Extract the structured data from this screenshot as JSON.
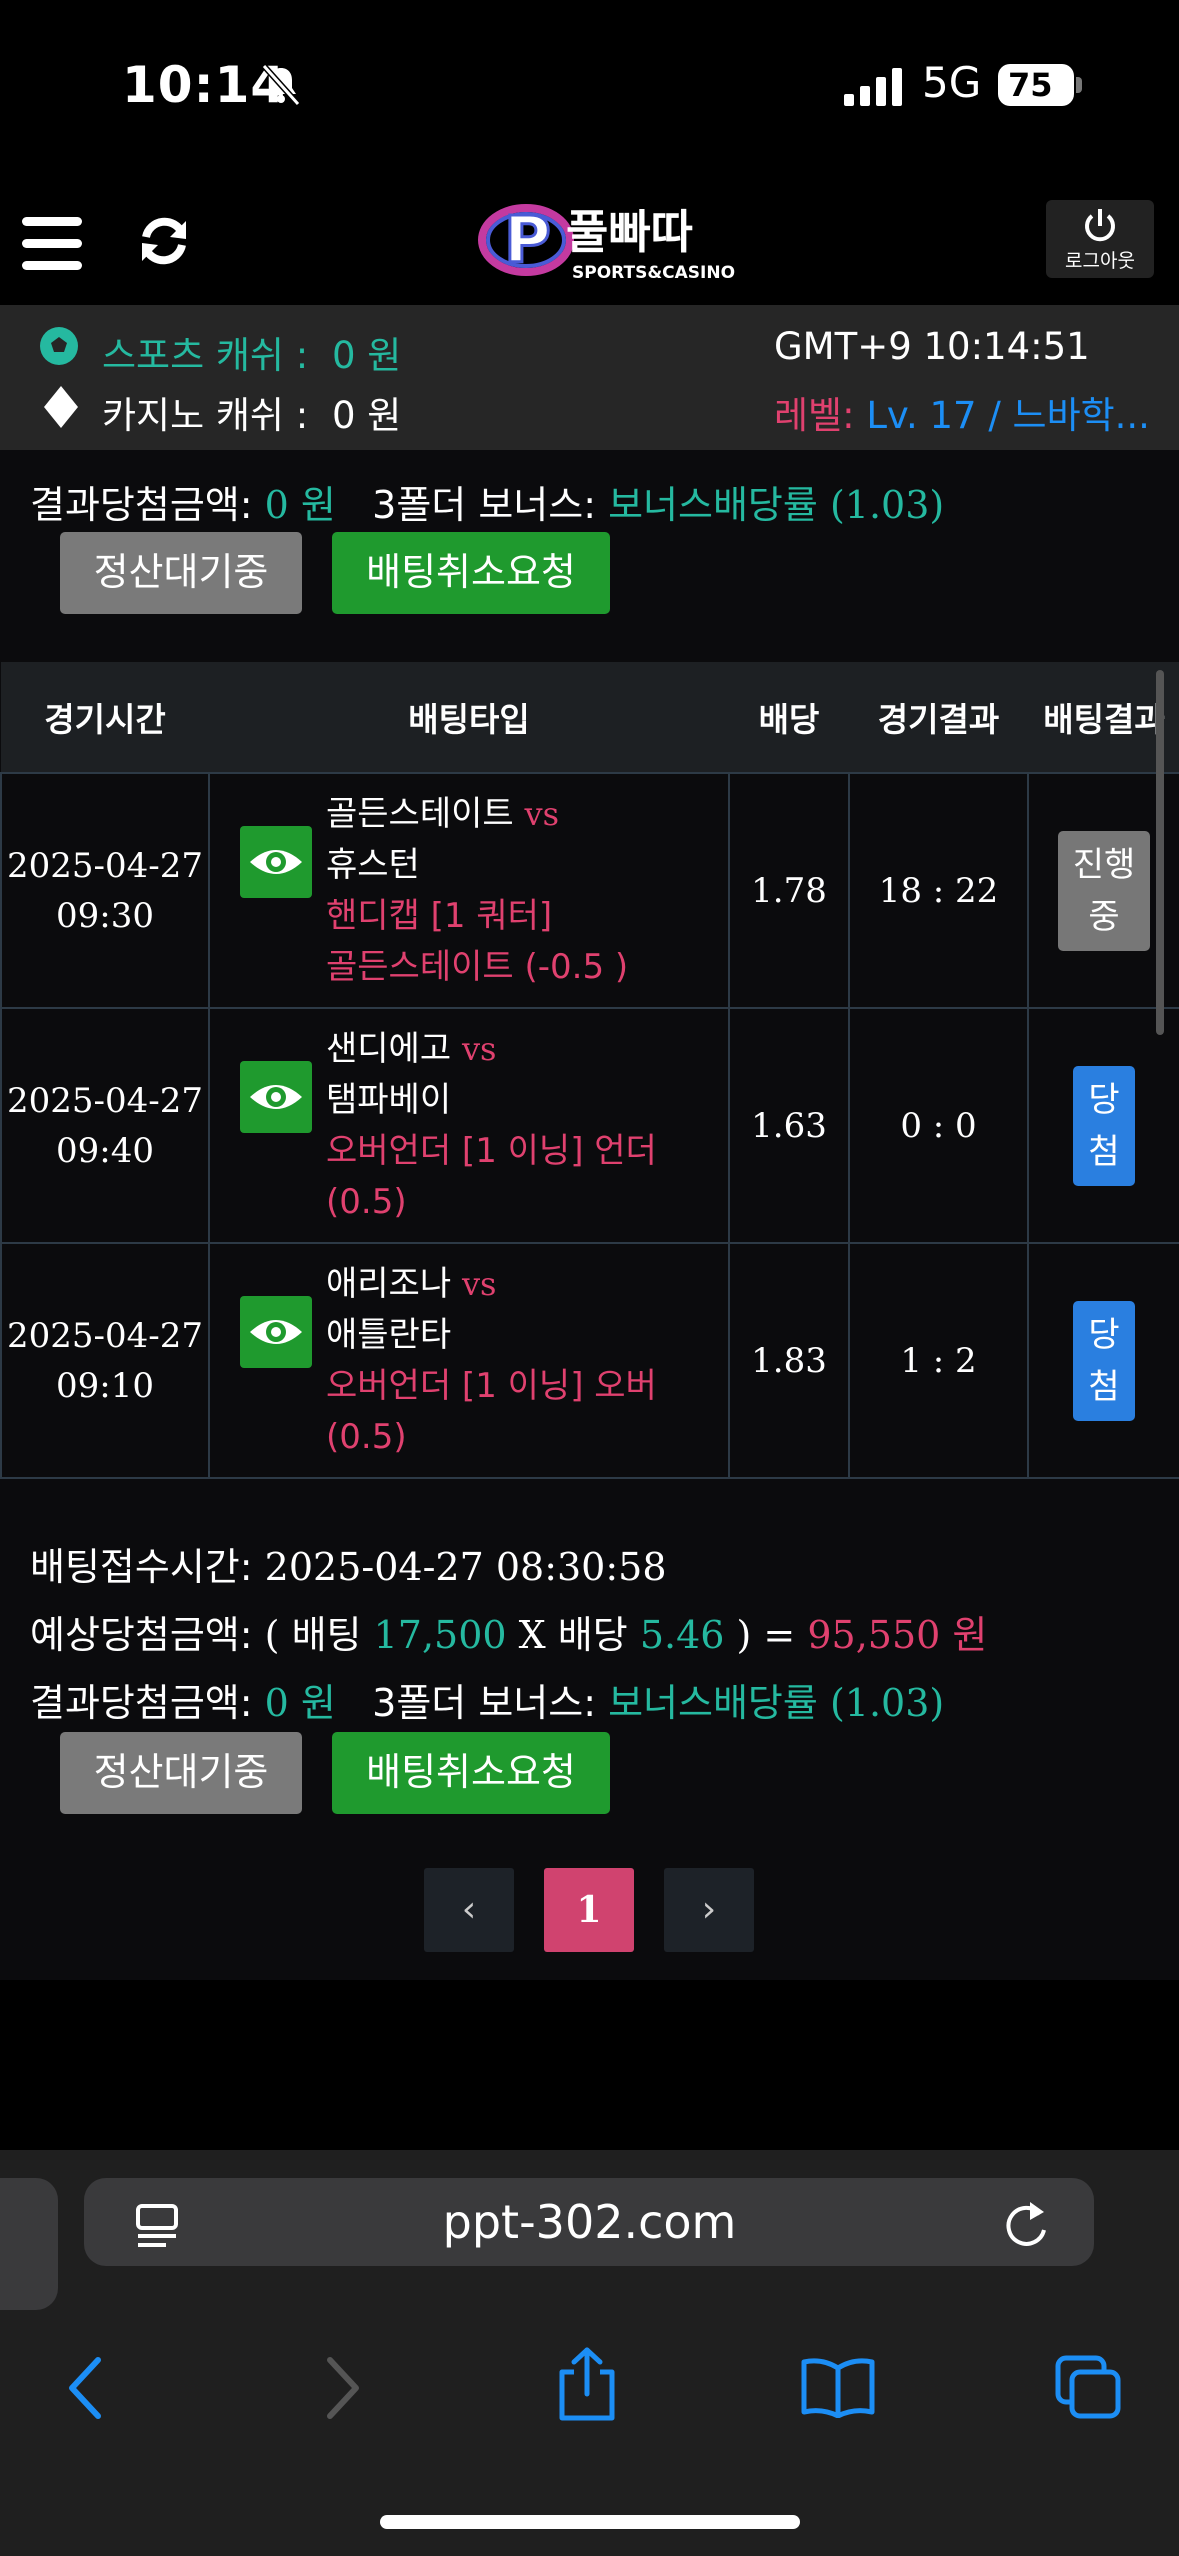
{
  "status_bar": {
    "time": "10:14",
    "network": "5G",
    "battery": "75"
  },
  "header": {
    "logo_text": "풀빠따",
    "logo_sub": "SPORTS&CASINO",
    "logout_label": "로그아웃"
  },
  "info": {
    "sports_cash_label": "스포츠 캐쉬 :",
    "sports_cash_value": "0 원",
    "casino_cash_label": "카지노 캐쉬 :",
    "casino_cash_value": "0 원",
    "clock": "GMT+9 10:14:51",
    "level_label": "레벨:",
    "level_value": "Lv. 17 / 느바학..."
  },
  "top_summary": {
    "result_label": "결과당첨금액:",
    "result_value": "0 원",
    "bonus_label": "3폴더 보너스:",
    "bonus_value": "보너스배당률",
    "bonus_rate": "(1.03)",
    "pending_label": "정산대기중",
    "cancel_label": "배팅취소요청"
  },
  "table": {
    "headers": [
      "경기시간",
      "배팅타입",
      "배당",
      "경기결과",
      "배팅결과"
    ],
    "rows": [
      {
        "date": "2025-04-27",
        "time": "09:30",
        "home": "골든스테이트",
        "vs": "vs",
        "away": "휴스턴",
        "bet_type": "핸디캡 [1 쿼터]",
        "pick": "골든스테이트 (-0.5 )",
        "odds": "1.78",
        "score": "18 : 22",
        "result": "진행중",
        "result_color": "#777777"
      },
      {
        "date": "2025-04-27",
        "time": "09:40",
        "home": "샌디에고",
        "vs": "vs",
        "away": "탬파베이",
        "bet_type": "오버언더 [1 이닝] 언더",
        "pick": "(0.5)",
        "odds": "1.63",
        "score": "0 : 0",
        "result": "당첨",
        "result_color": "#2a7fe0"
      },
      {
        "date": "2025-04-27",
        "time": "09:10",
        "home": "애리조나",
        "vs": "vs",
        "away": "애틀란타",
        "bet_type": "오버언더 [1 이닝] 오버",
        "pick": "(0.5)",
        "odds": "1.83",
        "score": "1 : 2",
        "result": "당첨",
        "result_color": "#2a7fe0"
      }
    ]
  },
  "summary": {
    "accept_label": "배팅접수시간:",
    "accept_value": "2025-04-27 08:30:58",
    "expected_label": "예상당첨금액:",
    "open_paren": "( 배팅",
    "stake": "17,500",
    "x_label": "X 배당",
    "odds": "5.46",
    "close_eq": ") =",
    "payout": "95,550 원",
    "result_label": "결과당첨금액:",
    "result_value": "0 원",
    "bonus_label": "3폴더 보너스:",
    "bonus_value": "보너스배당률",
    "bonus_rate": "(1.03)",
    "pending_label": "정산대기중",
    "cancel_label": "배팅취소요청"
  },
  "pagination": {
    "prev": "‹",
    "current": "1",
    "next": "›"
  },
  "browser": {
    "url": "ppt-302.com"
  },
  "colors": {
    "teal": "#25b9a0",
    "pink": "#e0416f",
    "blue": "#1c8ef5",
    "green": "#1f9a2e",
    "pager_active": "#d0436f"
  }
}
